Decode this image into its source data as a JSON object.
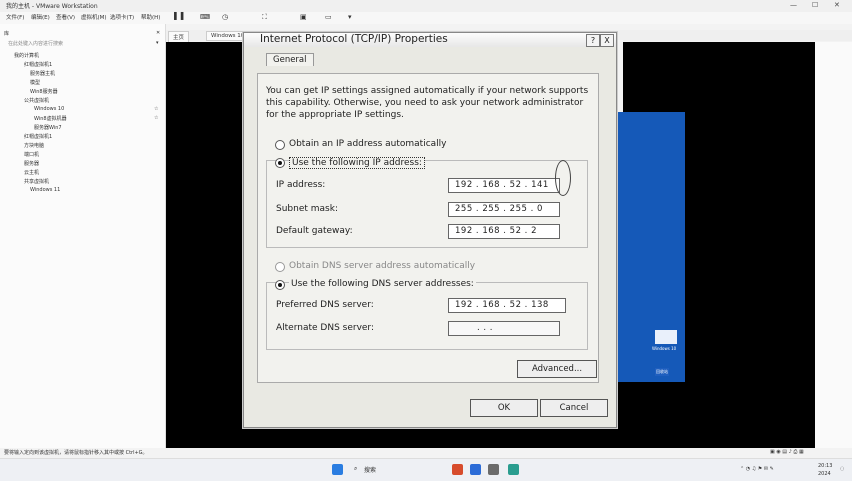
{
  "host": {
    "title": "我的主机 - VMware Workstation",
    "menu": [
      "文件(F)",
      "编辑(E)",
      "查看(V)",
      "虚拟机(M)",
      "选项卡(T)",
      "帮助(H)"
    ],
    "library_header": "库",
    "search_placeholder": "在此处键入内容进行搜索",
    "tree": [
      "我的计算机",
      "红帽虚拟机1",
      "服务器主机",
      "模型",
      "Win8服务器",
      "公共虚拟机",
      "Windows 10",
      "Win8虚拟机器",
      "服务器Win7",
      "红帽虚拟机1",
      "方块电脑",
      "端口机",
      "服务器",
      "云主机",
      "共享虚拟机",
      "Windows 11"
    ],
    "tab_home": "主页",
    "tab_vm": "Windows 10",
    "status": "要将输入定向到该虚拟机，请将鼠标指针移入其中或按 Ctrl+G。",
    "desktop_icon_label": "Windows 10",
    "recycle_label": "回收站",
    "taskbar_search": "搜索",
    "tray_time": "20:13",
    "tray_date": "2024"
  },
  "dialog": {
    "title": "Internet Protocol (TCP/IP) Properties",
    "help_btn": "?",
    "close_btn": "X",
    "tab": "General",
    "intro": [
      "You can get IP settings assigned automatically if your network supports",
      "this capability. Otherwise, you need to ask your network administrator",
      "for the appropriate IP settings."
    ],
    "ip_auto": "Obtain an IP address automatically",
    "ip_manual": "Use the following IP address:",
    "ip_label": "IP address:",
    "ip_value": "192 . 168 . 52 . 141",
    "mask_label": "Subnet mask:",
    "mask_value": "255 . 255 . 255 . 0",
    "gateway_label": "Default gateway:",
    "gateway_value": "192 . 168 . 52 . 2",
    "dns_auto": "Obtain DNS server address automatically",
    "dns_manual": "Use the following DNS server addresses:",
    "dns_pref_label": "Preferred DNS server:",
    "dns_pref_value": "192 . 168 . 52 . 138",
    "dns_alt_label": "Alternate DNS server:",
    "dns_alt_value": ".        .        .",
    "advanced": "Advanced...",
    "ok": "OK",
    "cancel": "Cancel"
  },
  "colors": {
    "guest_bg": "#1559b8",
    "vm_bg": "#000000",
    "dialog_bg": "#e9e9e3"
  }
}
